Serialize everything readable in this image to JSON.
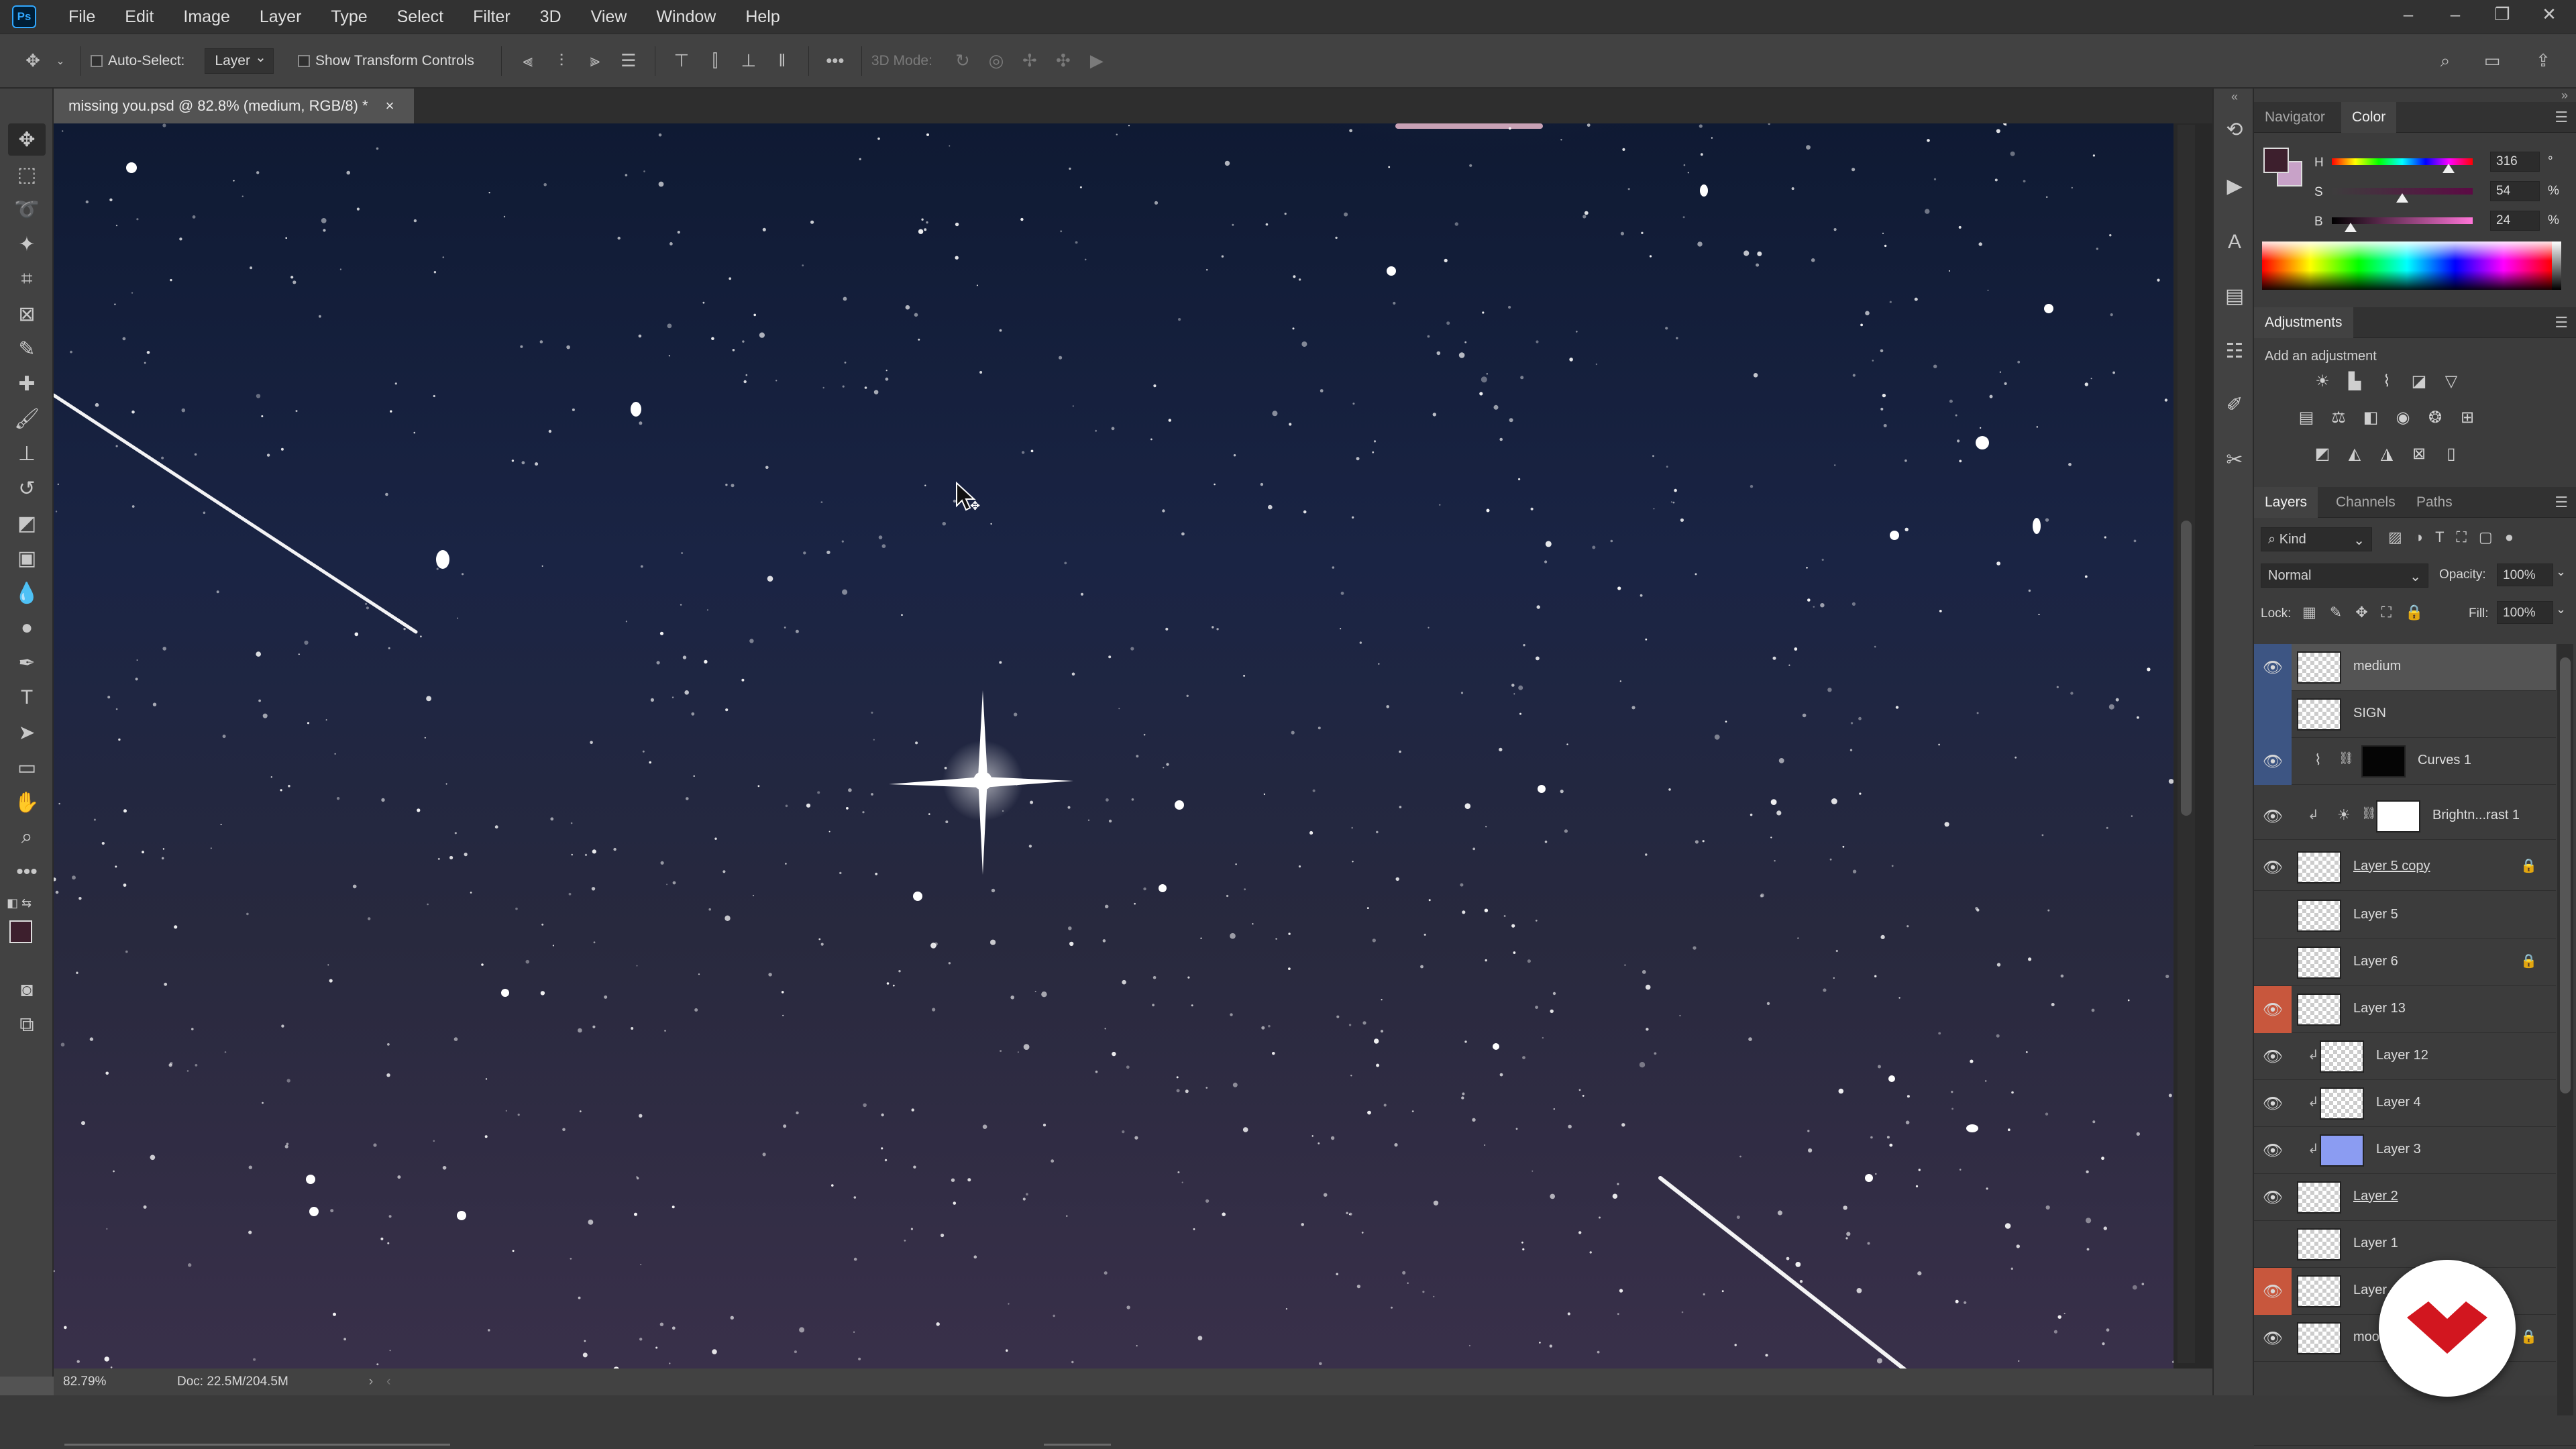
{
  "app": {
    "logo_text": "Ps"
  },
  "menu": [
    "File",
    "Edit",
    "Image",
    "Layer",
    "Type",
    "Select",
    "Filter",
    "3D",
    "View",
    "Window",
    "Help"
  ],
  "window_controls": {
    "minimize": "–",
    "restore": "❐",
    "close": "✕"
  },
  "options": {
    "auto_select_label": "Auto-Select:",
    "auto_select_target": "Layer",
    "show_transform_label": "Show Transform Controls",
    "mode_3d_label": "3D Mode:"
  },
  "document": {
    "tab_title": "missing you.psd @ 82.8% (medium, RGB/8) *",
    "close_glyph": "×"
  },
  "status": {
    "zoom": "82.79%",
    "doc_size": "Doc: 22.5M/204.5M"
  },
  "panels": {
    "navigator_tab": "Navigator",
    "color_tab": "Color",
    "adjustments_tab": "Adjustments",
    "adjustments_hint": "Add an adjustment",
    "layers_tab": "Layers",
    "channels_tab": "Channels",
    "paths_tab": "Paths"
  },
  "color": {
    "foreground": "#3d1f2d",
    "background": "#c8a2c8",
    "h": {
      "label": "H",
      "value": "316",
      "unit": "°"
    },
    "s": {
      "label": "S",
      "value": "54",
      "unit": "%"
    },
    "b": {
      "label": "B",
      "value": "24",
      "unit": "%"
    }
  },
  "layers_panel": {
    "filter_kind": "Kind",
    "blend_mode": "Normal",
    "opacity_label": "Opacity:",
    "opacity_value": "100%",
    "lock_label": "Lock:",
    "fill_label": "Fill:",
    "fill_value": "100%"
  },
  "layers": [
    {
      "name": "medium",
      "visible": true,
      "eye_style": "blue",
      "selected": true,
      "locked": false
    },
    {
      "name": "SIGN",
      "visible": false,
      "eye_style": "blue",
      "selected": false,
      "locked": false
    },
    {
      "name": "Curves 1",
      "visible": true,
      "eye_style": "blue",
      "selected": false,
      "locked": false
    },
    {
      "name": "Brightn...rast 1",
      "visible": true,
      "eye_style": "none",
      "selected": false,
      "locked": false
    },
    {
      "name": "Layer 5 copy",
      "visible": true,
      "eye_style": "none",
      "selected": false,
      "locked": true
    },
    {
      "name": "Layer 5",
      "visible": false,
      "eye_style": "none",
      "selected": false,
      "locked": false
    },
    {
      "name": "Layer 6",
      "visible": false,
      "eye_style": "none",
      "selected": false,
      "locked": true
    },
    {
      "name": "Layer 13",
      "visible": true,
      "eye_style": "red",
      "selected": false,
      "locked": false
    },
    {
      "name": "Layer 12",
      "visible": true,
      "eye_style": "none",
      "selected": false,
      "locked": false
    },
    {
      "name": "Layer 4",
      "visible": true,
      "eye_style": "none",
      "selected": false,
      "locked": false
    },
    {
      "name": "Layer 3",
      "visible": true,
      "eye_style": "none",
      "selected": false,
      "locked": false
    },
    {
      "name": "Layer 2",
      "visible": true,
      "eye_style": "none",
      "selected": false,
      "locked": false
    },
    {
      "name": "Layer 1",
      "visible": false,
      "eye_style": "none",
      "selected": false,
      "locked": false
    },
    {
      "name": "Layer",
      "visible": true,
      "eye_style": "red",
      "selected": false,
      "locked": false
    },
    {
      "name": "moo",
      "visible": true,
      "eye_style": "none",
      "selected": false,
      "locked": true
    }
  ],
  "icons": {
    "eye": "eye-icon",
    "lock": "lock-icon",
    "clip": "clipping-mask-icon"
  },
  "brand": {
    "logo_color": "#d2161f"
  }
}
